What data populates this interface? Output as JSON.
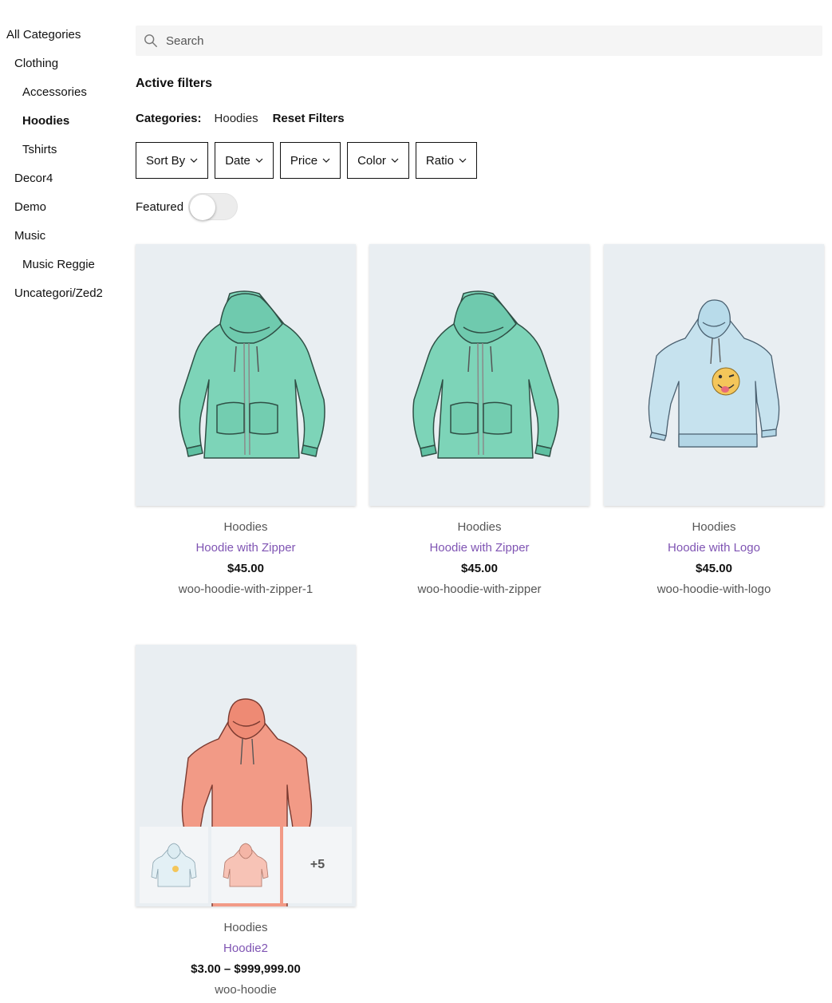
{
  "sidebar": {
    "categories": [
      {
        "label": "All Categories",
        "level": 0
      },
      {
        "label": "Clothing",
        "level": 1
      },
      {
        "label": "Accessories",
        "level": 2
      },
      {
        "label": "Hoodies",
        "level": 2,
        "active": true
      },
      {
        "label": "Tshirts",
        "level": 2
      },
      {
        "label": "Decor4",
        "level": 1
      },
      {
        "label": "Demo",
        "level": 1
      },
      {
        "label": "Music",
        "level": 1
      },
      {
        "label": "Music Reggie",
        "level": 2
      },
      {
        "label": "Uncategori/Zed2",
        "level": 1
      }
    ]
  },
  "search": {
    "placeholder": "Search",
    "value": "",
    "icon": "search-icon"
  },
  "active_filters": {
    "title": "Active filters",
    "label": "Categories:",
    "value": "Hoodies",
    "reset": "Reset Filters"
  },
  "filters": [
    {
      "label": "Sort By"
    },
    {
      "label": "Date"
    },
    {
      "label": "Price"
    },
    {
      "label": "Color"
    },
    {
      "label": "Ratio"
    }
  ],
  "featured": {
    "label": "Featured",
    "on": false
  },
  "products": [
    {
      "category": "Hoodies",
      "name": "Hoodie with Zipper",
      "price": "$45.00",
      "slug": "woo-hoodie-with-zipper-1",
      "image": "green-zip-hoodie"
    },
    {
      "category": "Hoodies",
      "name": "Hoodie with Zipper",
      "price": "$45.00",
      "slug": "woo-hoodie-with-zipper",
      "image": "green-zip-hoodie"
    },
    {
      "category": "Hoodies",
      "name": "Hoodie with Logo",
      "price": "$45.00",
      "slug": "woo-hoodie-with-logo",
      "image": "blue-logo-hoodie"
    },
    {
      "category": "Hoodies",
      "name": "Hoodie2",
      "price": "$3.00 – $999,999.00",
      "slug": "woo-hoodie",
      "image": "pink-hoodie",
      "more_images": "+5"
    }
  ],
  "colors": {
    "link": "#7f54b3",
    "card_bg": "#e9eef2",
    "green_hoodie": "#7dd4b8",
    "blue_hoodie": "#c6e2ee",
    "pink_hoodie": "#f29a86"
  }
}
